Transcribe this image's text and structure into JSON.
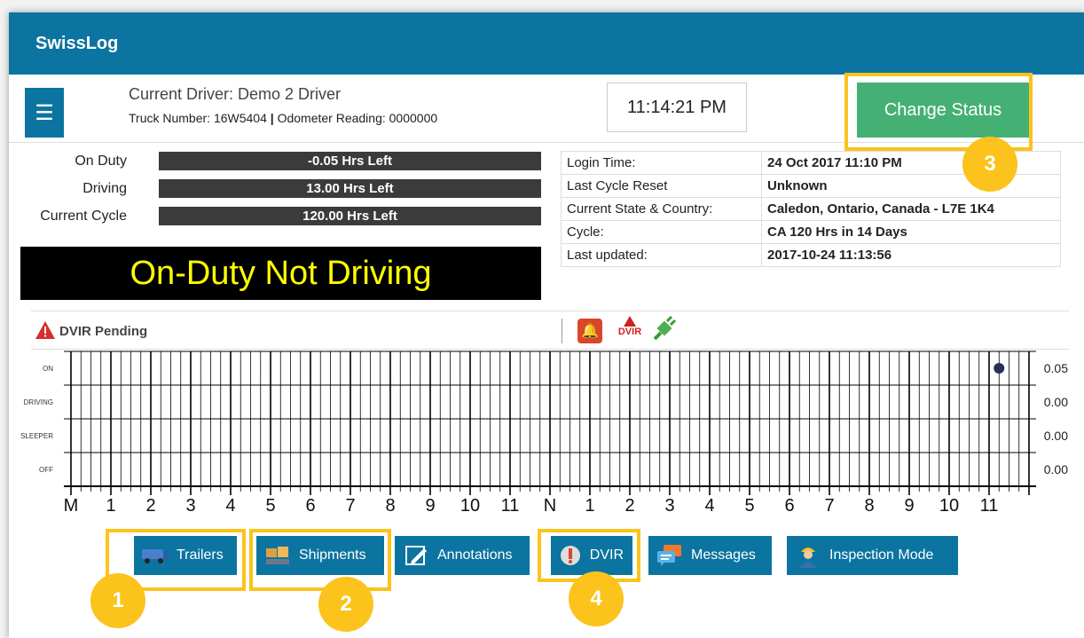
{
  "app": {
    "title": "SwissLog"
  },
  "header": {
    "driver": "Current Driver: Demo 2 Driver",
    "truck_label": "Truck Number: 16W5404",
    "sep": "|",
    "odometer": "Odometer Reading: 0000000",
    "clock": "11:14:21 PM",
    "change_status": "Change Status"
  },
  "hours": [
    {
      "label": "On Duty",
      "value": "-0.05 Hrs Left"
    },
    {
      "label": "Driving",
      "value": "13.00 Hrs Left"
    },
    {
      "label": "Current Cycle",
      "value": "120.00 Hrs Left"
    }
  ],
  "status_display": "On-Duty Not Driving",
  "info": [
    {
      "key": "Login Time:",
      "value": "24 Oct 2017 11:10 PM"
    },
    {
      "key": "Last Cycle Reset",
      "value": "Unknown"
    },
    {
      "key": "Current State & Country:",
      "value": "Caledon, Ontario, Canada - L7E 1K4"
    },
    {
      "key": "Cycle:",
      "value": "CA 120 Hrs in 14 Days"
    },
    {
      "key": "Last updated:",
      "value": "2017-10-24 11:13:56"
    }
  ],
  "dvir": {
    "pending": "DVIR Pending",
    "mini_icon_text": "DVIR"
  },
  "logchart": {
    "rows": [
      "ON",
      "DRIVING",
      "SLEEPER",
      "OFF"
    ],
    "totals": [
      "0.05",
      "0.00",
      "0.00",
      "0.00"
    ],
    "hour_labels": [
      "M",
      "1",
      "2",
      "3",
      "4",
      "5",
      "6",
      "7",
      "8",
      "9",
      "10",
      "11",
      "N",
      "1",
      "2",
      "3",
      "4",
      "5",
      "6",
      "7",
      "8",
      "9",
      "10",
      "11"
    ],
    "current_hour": 23.25,
    "current_row": 0
  },
  "nav": {
    "trailers": "Trailers",
    "shipments": "Shipments",
    "annotations": "Annotations",
    "dvir": "DVIR",
    "messages": "Messages",
    "inspection": "Inspection Mode"
  },
  "callouts": [
    "1",
    "2",
    "3",
    "4"
  ],
  "colors": {
    "brand": "#0c74a0",
    "status_green": "#45b074",
    "callout": "#fbc31c",
    "status_text": "#ffff00"
  }
}
